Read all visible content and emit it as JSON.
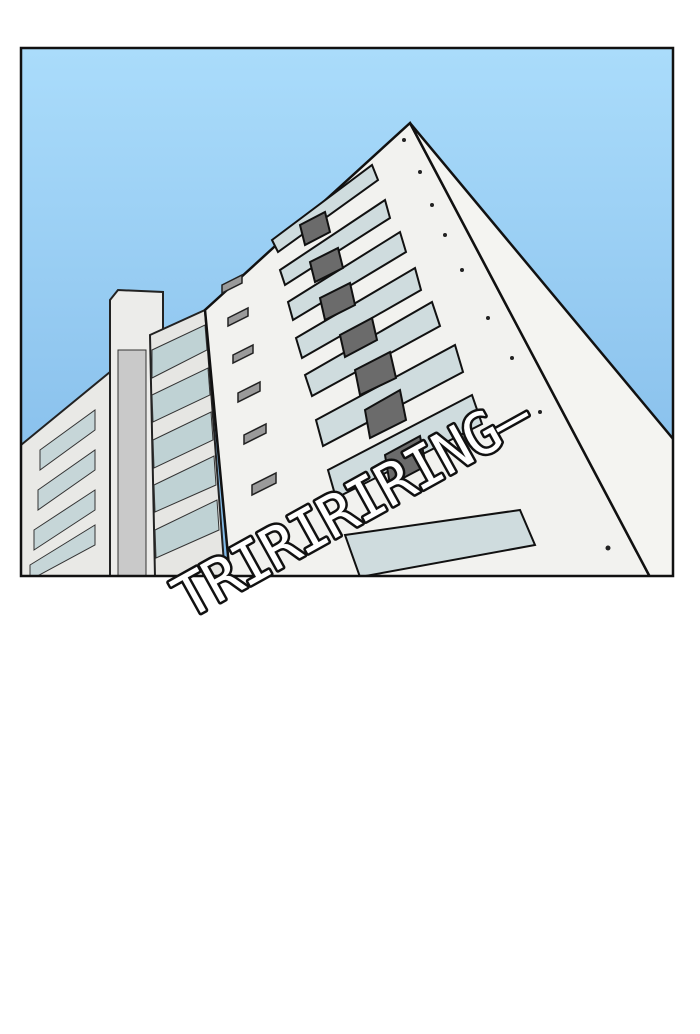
{
  "panel": {
    "sound_effect": "TRIRIRIRING—",
    "colors": {
      "sky_top": "#a9dcfb",
      "sky_bottom": "#7fb9e8",
      "building": "#f1f1ee",
      "window_glass": "#c9d8da",
      "window_dark": "#6d6d6d",
      "outline": "#111111"
    }
  }
}
